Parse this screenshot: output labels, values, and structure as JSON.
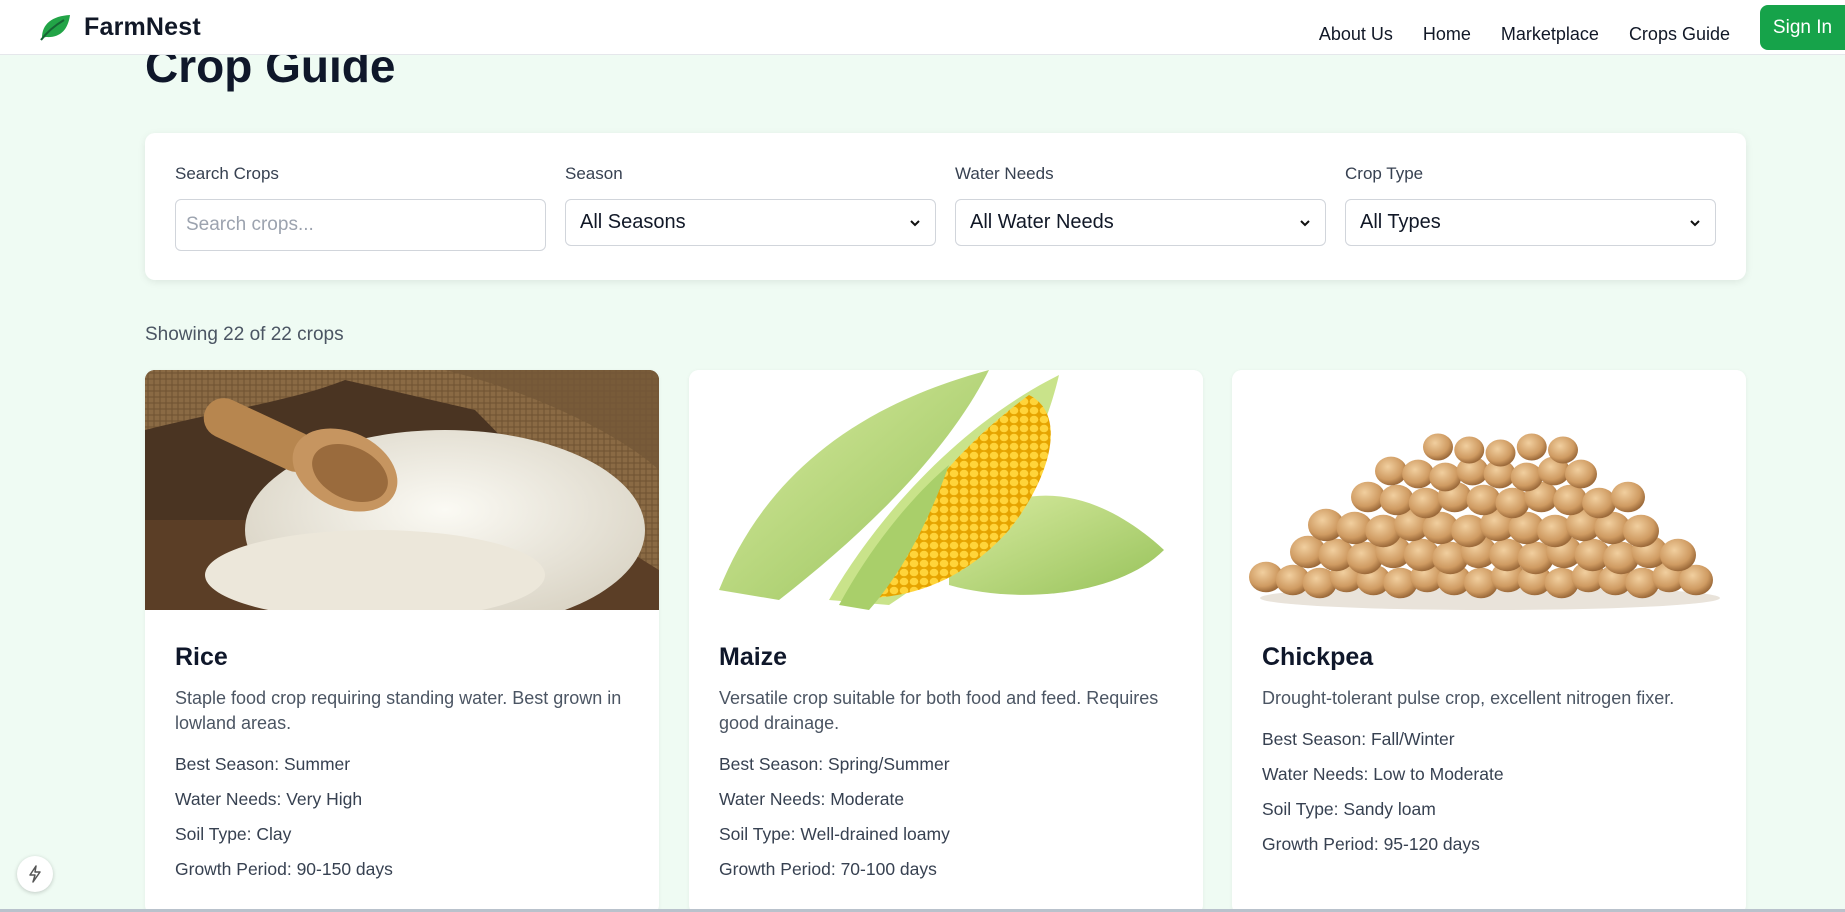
{
  "header": {
    "brand": "FarmNest",
    "nav": [
      "About Us",
      "Home",
      "Marketplace",
      "Crops Guide"
    ],
    "signin_label": "Sign In",
    "accent_color": "#16a34a"
  },
  "page": {
    "title": "Crop Guide"
  },
  "filters": {
    "search": {
      "label": "Search Crops",
      "placeholder": "Search crops...",
      "value": ""
    },
    "season": {
      "label": "Season",
      "selected": "All Seasons"
    },
    "water": {
      "label": "Water Needs",
      "selected": "All Water Needs"
    },
    "type": {
      "label": "Crop Type",
      "selected": "All Types"
    }
  },
  "results": {
    "count_text": "Showing 22 of 22 crops"
  },
  "crops": [
    {
      "name": "Rice",
      "image": "rice-sack-photo",
      "description": "Staple food crop requiring standing water. Best grown in lowland areas.",
      "season": "Best Season: Summer",
      "water": "Water Needs: Very High",
      "soil": "Soil Type: Clay",
      "growth": "Growth Period: 90-150 days"
    },
    {
      "name": "Maize",
      "image": "corn-cob-photo",
      "description": "Versatile crop suitable for both food and feed. Requires good drainage.",
      "season": "Best Season: Spring/Summer",
      "water": "Water Needs: Moderate",
      "soil": "Soil Type: Well-drained loamy",
      "growth": "Growth Period: 70-100 days"
    },
    {
      "name": "Chickpea",
      "image": "chickpea-pile-photo",
      "description": "Drought-tolerant pulse crop, excellent nitrogen fixer.",
      "season": "Best Season: Fall/Winter",
      "water": "Water Needs: Low to Moderate",
      "soil": "Soil Type: Sandy loam",
      "growth": "Growth Period: 95-120 days"
    }
  ]
}
